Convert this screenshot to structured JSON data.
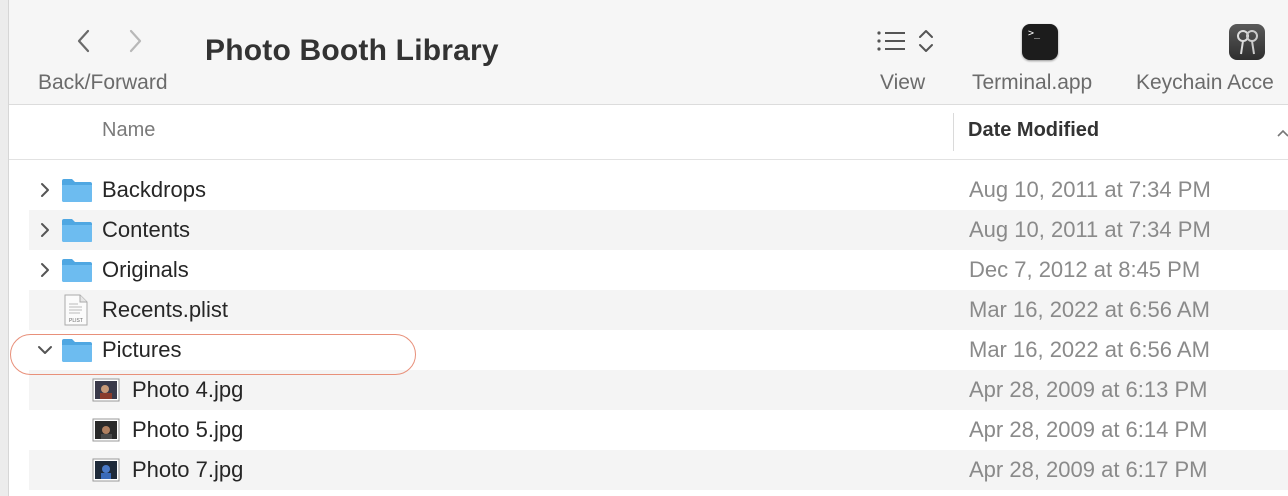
{
  "toolbar": {
    "back_forward_label": "Back/Forward",
    "title": "Photo Booth Library",
    "view_label": "View",
    "terminal_label": "Terminal.app",
    "keychain_label": "Keychain Acce",
    "terminal_prompt": ">_"
  },
  "header": {
    "name": "Name",
    "date_modified": "Date Modified"
  },
  "rows": [
    {
      "name": "Backdrops",
      "date": "Aug 10, 2011 at 7:34 PM",
      "kind": "folder",
      "expanded": false
    },
    {
      "name": "Contents",
      "date": "Aug 10, 2011 at 7:34 PM",
      "kind": "folder",
      "expanded": false
    },
    {
      "name": "Originals",
      "date": "Dec 7, 2012 at 8:45 PM",
      "kind": "folder",
      "expanded": false
    },
    {
      "name": "Recents.plist",
      "date": "Mar 16, 2022 at 6:56 AM",
      "kind": "plist",
      "icon_text": "PLIST"
    },
    {
      "name": "Pictures",
      "date": "Mar 16, 2022 at 6:56 AM",
      "kind": "folder",
      "expanded": true
    },
    {
      "name": "Photo 4.jpg",
      "date": "Apr 28, 2009 at 6:13 PM",
      "kind": "image"
    },
    {
      "name": "Photo 5.jpg",
      "date": "Apr 28, 2009 at 6:14 PM",
      "kind": "image"
    },
    {
      "name": "Photo 7.jpg",
      "date": "Apr 28, 2009 at 6:17 PM",
      "kind": "image"
    }
  ],
  "colors": {
    "folder": "#5fb3ea",
    "highlight": "#e8907a",
    "alt_row": "#f4f4f4"
  }
}
